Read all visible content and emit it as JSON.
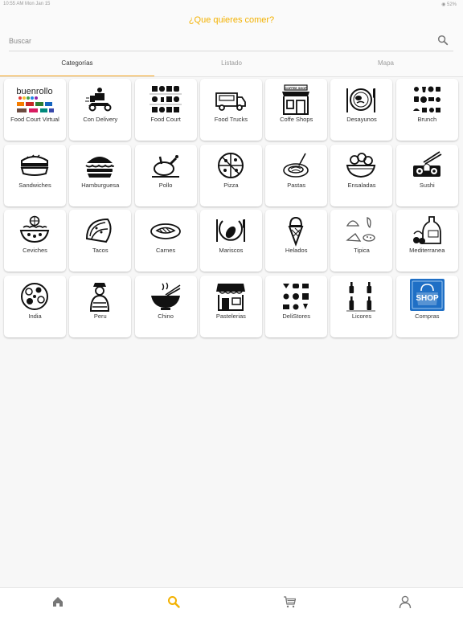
{
  "app": {
    "title": "¿Que quieres comer?",
    "accent_color": "#f3b100",
    "tab_indicator_color": "#f6a623"
  },
  "status_bar": {
    "left_text": "10:55 AM   Mon Jan 15",
    "right_text": "◉ 52%"
  },
  "search": {
    "placeholder": "Buscar",
    "value": "",
    "icon": "search-icon"
  },
  "tabs": [
    {
      "label": "Categorías",
      "active": true
    },
    {
      "label": "Listado",
      "active": false
    },
    {
      "label": "Mapa",
      "active": false
    }
  ],
  "categories": [
    {
      "label": "Food Court Virtual",
      "logo_text": "buenrollo"
    },
    {
      "label": "Con Delivery",
      "icon": "delivery-scooter-icon"
    },
    {
      "label": "Food Court",
      "icon": "food-court-icon"
    },
    {
      "label": "Food Trucks",
      "icon": "food-truck-icon"
    },
    {
      "label": "Coffe Shops",
      "icon": "coffee-shop-icon",
      "sign_text": "COFFEE SHOP"
    },
    {
      "label": "Desayunos",
      "icon": "breakfast-plate-icon"
    },
    {
      "label": "Brunch",
      "icon": "brunch-icon"
    },
    {
      "label": "Sandwiches",
      "icon": "sandwich-icon"
    },
    {
      "label": "Hamburguesa",
      "icon": "burger-icon"
    },
    {
      "label": "Pollo",
      "icon": "chicken-icon"
    },
    {
      "label": "Pizza",
      "icon": "pizza-icon"
    },
    {
      "label": "Pastas",
      "icon": "pasta-icon"
    },
    {
      "label": "Ensaladas",
      "icon": "salad-icon"
    },
    {
      "label": "Sushi",
      "icon": "sushi-icon"
    },
    {
      "label": "Ceviches",
      "icon": "ceviche-icon"
    },
    {
      "label": "Tacos",
      "icon": "taco-icon"
    },
    {
      "label": "Carnes",
      "icon": "steak-icon"
    },
    {
      "label": "Mariscos",
      "icon": "seafood-icon"
    },
    {
      "label": "Helados",
      "icon": "ice-cream-icon"
    },
    {
      "label": "Tipica",
      "icon": "typical-food-icon"
    },
    {
      "label": "Mediterranea",
      "icon": "olive-oil-icon"
    },
    {
      "label": "India",
      "icon": "indian-thali-icon"
    },
    {
      "label": "Peru",
      "icon": "peru-woman-icon"
    },
    {
      "label": "Chino",
      "icon": "chinese-bowl-icon"
    },
    {
      "label": "Pastelerias",
      "icon": "pastry-shop-icon"
    },
    {
      "label": "DeliStores",
      "icon": "deli-store-icon"
    },
    {
      "label": "Licores",
      "icon": "liquor-bottles-icon"
    },
    {
      "label": "Compras",
      "icon": "shop-bag-icon",
      "badge_text": "SHOP",
      "badge_color": "#1f6fc5"
    }
  ],
  "bottom_nav": [
    {
      "icon": "home-icon",
      "active": false
    },
    {
      "icon": "search-icon",
      "active": true
    },
    {
      "icon": "cart-icon",
      "active": false
    },
    {
      "icon": "profile-icon",
      "active": false
    }
  ]
}
